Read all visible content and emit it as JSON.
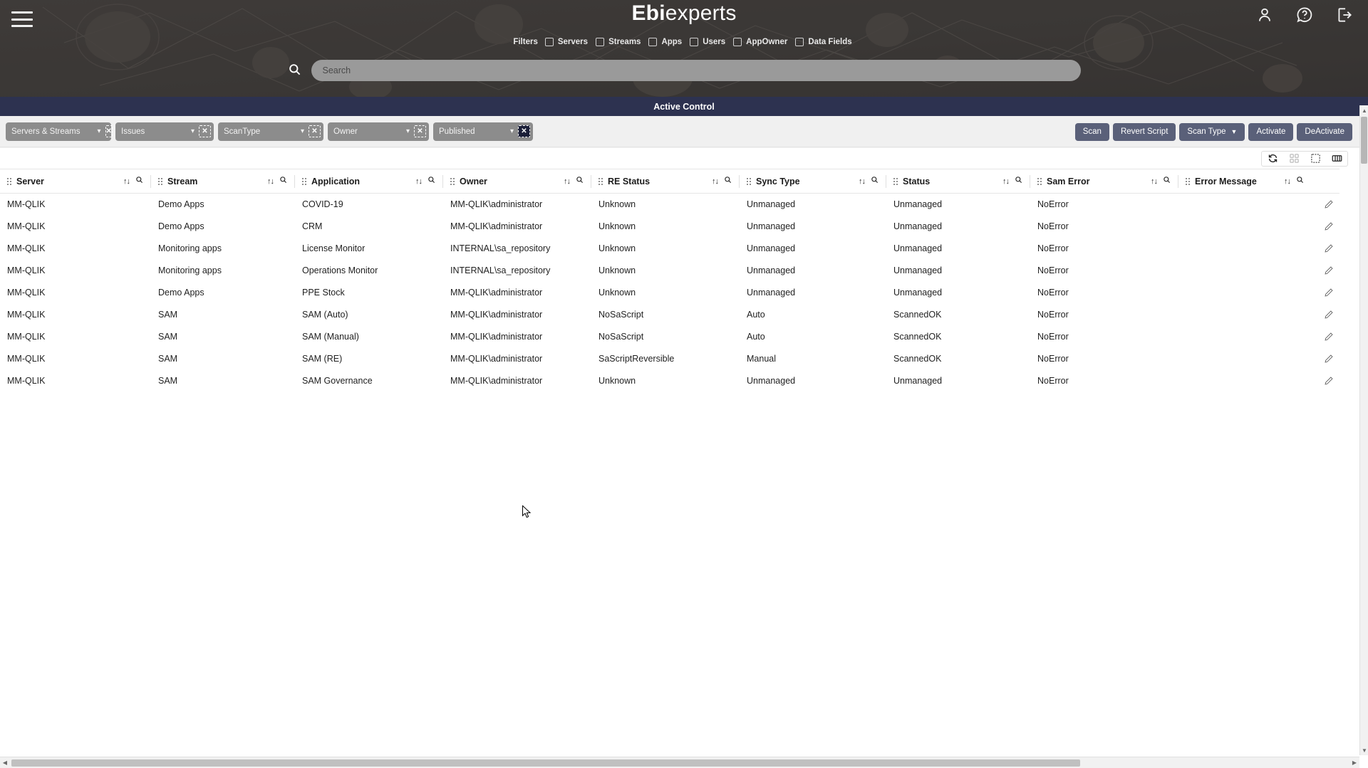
{
  "header": {
    "menu_icon": "hamburger-icon",
    "brand_bold": "Ebi",
    "brand_light": "experts",
    "filters_label": "Filters",
    "filters": [
      {
        "label": "Servers",
        "checked": false
      },
      {
        "label": "Streams",
        "checked": false
      },
      {
        "label": "Apps",
        "checked": false
      },
      {
        "label": "Users",
        "checked": false
      },
      {
        "label": "AppOwner",
        "checked": false
      },
      {
        "label": "Data Fields",
        "checked": false
      }
    ],
    "search": {
      "value": "",
      "placeholder": "Search",
      "icon": "search-icon"
    },
    "icons": [
      {
        "name": "user-icon"
      },
      {
        "name": "help-icon"
      },
      {
        "name": "logout-icon"
      }
    ],
    "background_color": "#3b3836"
  },
  "active_bar": {
    "title": "Active Control",
    "background_color": "#2d3250"
  },
  "toolbar": {
    "filter_dropdowns": [
      {
        "label": "Servers & Streams",
        "clear_icon": "clear-selection-icon",
        "focused": false
      },
      {
        "label": "Issues",
        "clear_icon": "clear-selection-icon",
        "focused": false
      },
      {
        "label": "ScanType",
        "clear_icon": "clear-selection-icon",
        "focused": false
      },
      {
        "label": "Owner",
        "clear_icon": "clear-selection-icon",
        "focused": false
      },
      {
        "label": "Published",
        "clear_icon": "clear-selection-icon",
        "focused": true
      }
    ],
    "buttons": [
      {
        "label": "Scan",
        "has_caret": false
      },
      {
        "label": "Revert Script",
        "has_caret": false
      },
      {
        "label": "Scan Type",
        "has_caret": true
      },
      {
        "label": "Activate",
        "has_caret": false
      },
      {
        "label": "DeActivate",
        "has_caret": false
      }
    ],
    "button_color": "#5a6079"
  },
  "grid_tools": [
    {
      "name": "refresh-icon",
      "dim": false
    },
    {
      "name": "grid-layout-icon",
      "dim": true
    },
    {
      "name": "clear-selection-icon",
      "dim": false
    },
    {
      "name": "columns-icon",
      "dim": false
    }
  ],
  "table": {
    "columns": [
      {
        "label": "Server"
      },
      {
        "label": "Stream"
      },
      {
        "label": "Application"
      },
      {
        "label": "Owner"
      },
      {
        "label": "RE Status"
      },
      {
        "label": "Sync Type"
      },
      {
        "label": "Status"
      },
      {
        "label": "Sam Error"
      },
      {
        "label": "Error Message"
      }
    ],
    "column_tools": {
      "sort_icon": "sort-icon",
      "search_icon": "column-search-icon"
    },
    "row_action_icon": "edit-pencil-icon",
    "rows": [
      {
        "server": "MM-QLIK",
        "stream": "Demo Apps",
        "application": "COVID-19",
        "owner": "MM-QLIK\\administrator",
        "re_status": "Unknown",
        "sync_type": "Unmanaged",
        "status": "Unmanaged",
        "sam_error": "NoError",
        "error_message": ""
      },
      {
        "server": "MM-QLIK",
        "stream": "Demo Apps",
        "application": "CRM",
        "owner": "MM-QLIK\\administrator",
        "re_status": "Unknown",
        "sync_type": "Unmanaged",
        "status": "Unmanaged",
        "sam_error": "NoError",
        "error_message": ""
      },
      {
        "server": "MM-QLIK",
        "stream": "Monitoring apps",
        "application": "License Monitor",
        "owner": "INTERNAL\\sa_repository",
        "re_status": "Unknown",
        "sync_type": "Unmanaged",
        "status": "Unmanaged",
        "sam_error": "NoError",
        "error_message": ""
      },
      {
        "server": "MM-QLIK",
        "stream": "Monitoring apps",
        "application": "Operations Monitor",
        "owner": "INTERNAL\\sa_repository",
        "re_status": "Unknown",
        "sync_type": "Unmanaged",
        "status": "Unmanaged",
        "sam_error": "NoError",
        "error_message": ""
      },
      {
        "server": "MM-QLIK",
        "stream": "Demo Apps",
        "application": "PPE Stock",
        "owner": "MM-QLIK\\administrator",
        "re_status": "Unknown",
        "sync_type": "Unmanaged",
        "status": "Unmanaged",
        "sam_error": "NoError",
        "error_message": ""
      },
      {
        "server": "MM-QLIK",
        "stream": "SAM",
        "application": "SAM (Auto)",
        "owner": "MM-QLIK\\administrator",
        "re_status": "NoSaScript",
        "sync_type": "Auto",
        "status": "ScannedOK",
        "sam_error": "NoError",
        "error_message": ""
      },
      {
        "server": "MM-QLIK",
        "stream": "SAM",
        "application": "SAM (Manual)",
        "owner": "MM-QLIK\\administrator",
        "re_status": "NoSaScript",
        "sync_type": "Auto",
        "status": "ScannedOK",
        "sam_error": "NoError",
        "error_message": ""
      },
      {
        "server": "MM-QLIK",
        "stream": "SAM",
        "application": "SAM (RE)",
        "owner": "MM-QLIK\\administrator",
        "re_status": "SaScriptReversible",
        "sync_type": "Manual",
        "status": "ScannedOK",
        "sam_error": "NoError",
        "error_message": ""
      },
      {
        "server": "MM-QLIK",
        "stream": "SAM",
        "application": "SAM Governance",
        "owner": "MM-QLIK\\administrator",
        "re_status": "Unknown",
        "sync_type": "Unmanaged",
        "status": "Unmanaged",
        "sam_error": "NoError",
        "error_message": ""
      }
    ]
  },
  "scrollbars": {
    "vertical": {
      "up_arrow": "▲",
      "down_arrow": "▼"
    },
    "horizontal": {
      "left_arrow": "◀",
      "right_arrow": "▶"
    }
  }
}
